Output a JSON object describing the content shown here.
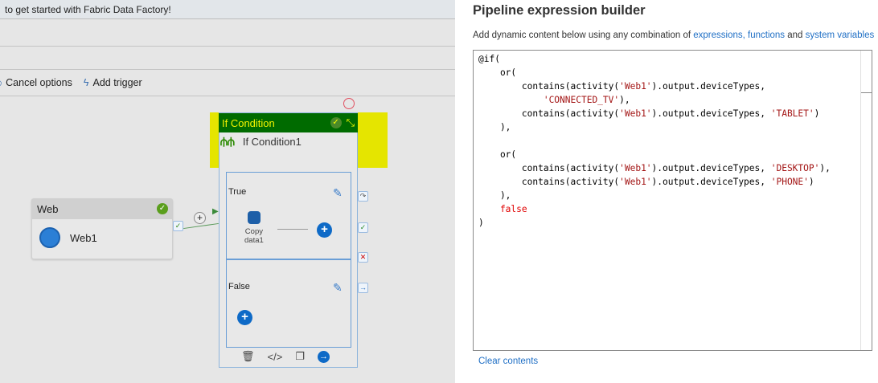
{
  "banner": {
    "text": "to get started with Fabric Data Factory!"
  },
  "toolbar": {
    "cancel_options": "Cancel options",
    "add_trigger": "Add trigger"
  },
  "web_activity": {
    "type": "Web",
    "name": "Web1"
  },
  "if_condition": {
    "type": "If Condition",
    "name": "If Condition1",
    "true_branch": {
      "label": "True",
      "activity_line1": "Copy",
      "activity_line2": "data1"
    },
    "false_branch": {
      "label": "False"
    }
  },
  "panel": {
    "title": "Pipeline expression builder",
    "desc_prefix": "Add dynamic content below using any combination of ",
    "link_expressions": "expressions,",
    "link_functions": "functions",
    "desc_and": " and ",
    "link_system_variables": "system variables",
    "clear_contents": "Clear contents",
    "code_lines": [
      [
        [
          "at",
          "@if("
        ]
      ],
      [
        [
          "fn",
          "    or("
        ]
      ],
      [
        [
          "fn",
          "        contains(activity("
        ],
        [
          "str",
          "'Web1'"
        ],
        [
          "fn",
          ").output.deviceTypes,"
        ]
      ],
      [
        [
          "fn",
          "            "
        ],
        [
          "str",
          "'CONNECTED_TV'"
        ],
        [
          "fn",
          "),"
        ]
      ],
      [
        [
          "fn",
          "        contains(activity("
        ],
        [
          "str",
          "'Web1'"
        ],
        [
          "fn",
          ").output.deviceTypes, "
        ],
        [
          "str",
          "'TABLET'"
        ],
        [
          "fn",
          ")"
        ]
      ],
      [
        [
          "fn",
          "    ),"
        ]
      ],
      [
        [
          "fn",
          " "
        ]
      ],
      [
        [
          "fn",
          "    or("
        ]
      ],
      [
        [
          "fn",
          "        contains(activity("
        ],
        [
          "str",
          "'Web1'"
        ],
        [
          "fn",
          ").output.deviceTypes, "
        ],
        [
          "str",
          "'DESKTOP'"
        ],
        [
          "fn",
          "),"
        ]
      ],
      [
        [
          "fn",
          "        contains(activity("
        ],
        [
          "str",
          "'Web1'"
        ],
        [
          "fn",
          ").output.deviceTypes, "
        ],
        [
          "str",
          "'PHONE'"
        ],
        [
          "fn",
          ")"
        ]
      ],
      [
        [
          "fn",
          "    ),"
        ]
      ],
      [
        [
          "kw",
          "    false"
        ]
      ],
      [
        [
          "fn",
          ")"
        ]
      ]
    ]
  }
}
